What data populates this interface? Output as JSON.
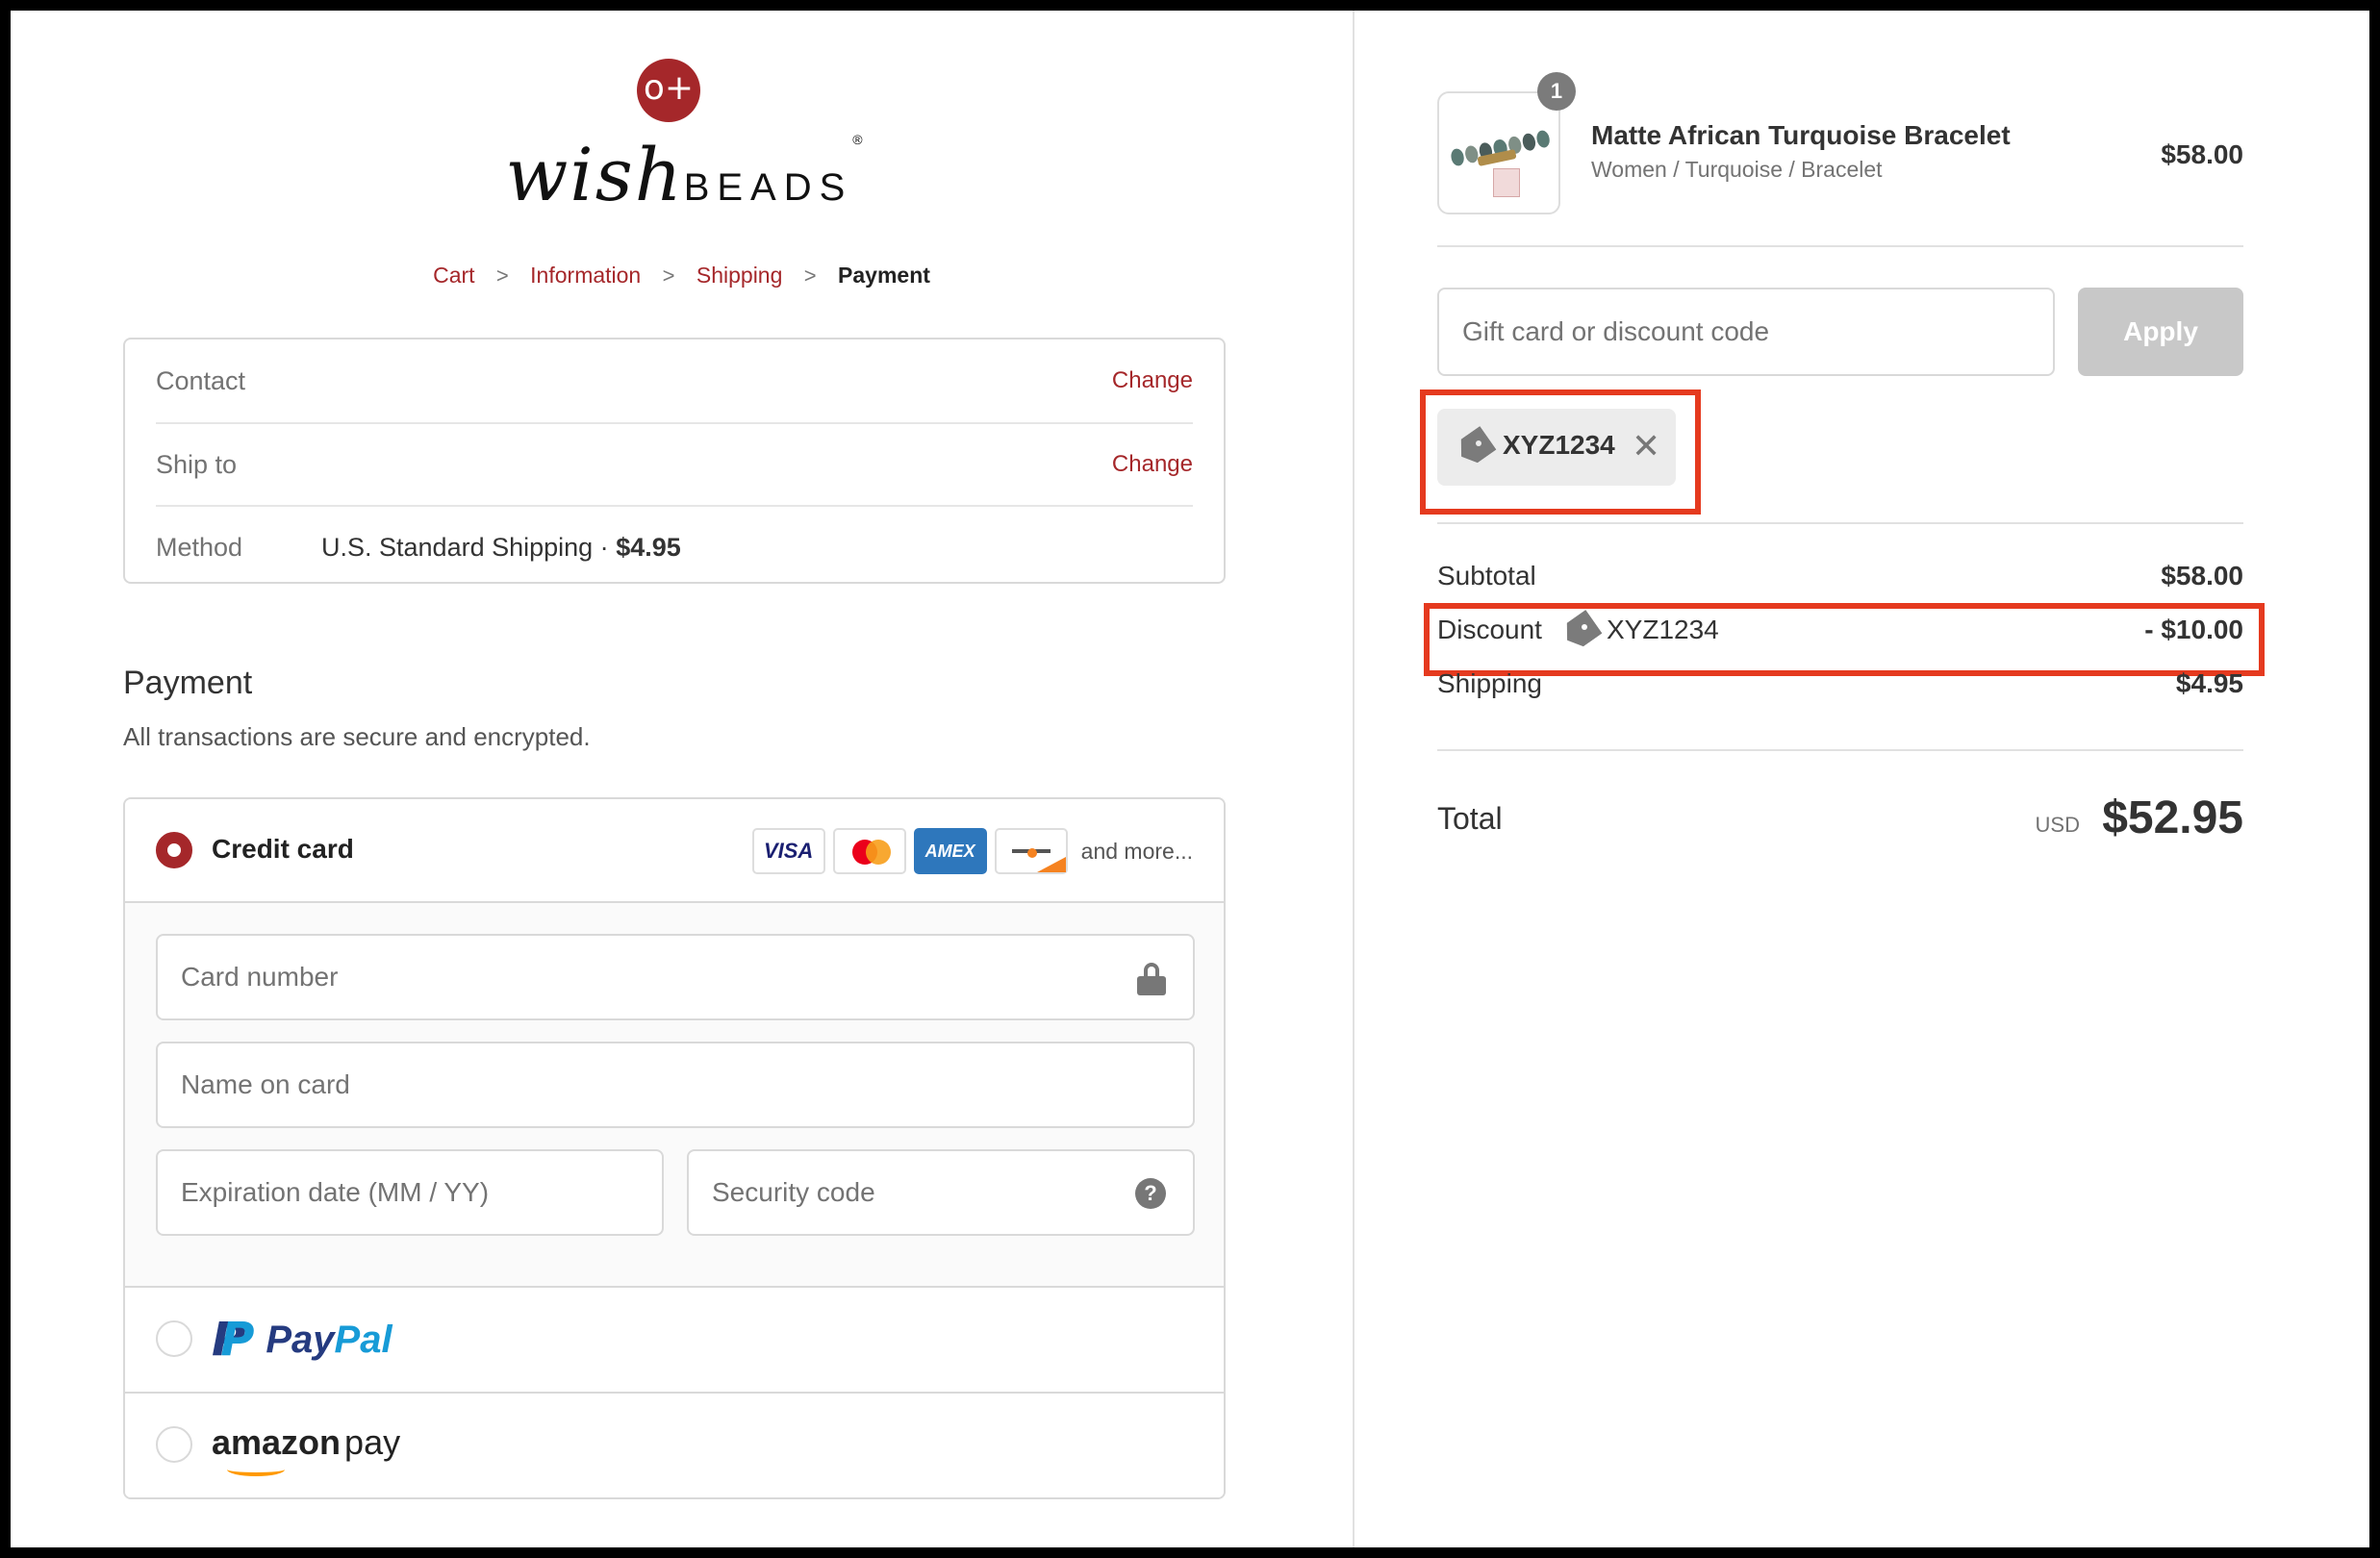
{
  "logo": {
    "mark": "o+",
    "script": "wish",
    "caps": "BEADS",
    "tm": "®"
  },
  "breadcrumb": {
    "cart": "Cart",
    "information": "Information",
    "shipping": "Shipping",
    "payment": "Payment",
    "separator": ">"
  },
  "review": {
    "contact_label": "Contact",
    "ship_to_label": "Ship to",
    "method_label": "Method",
    "method_value": "U.S. Standard Shipping · ",
    "method_price": "$4.95",
    "change_label": "Change"
  },
  "payment": {
    "title": "Payment",
    "subtitle": "All transactions are secure and encrypted.",
    "credit_card": {
      "label": "Credit card",
      "selected": true,
      "brands": {
        "visa": "VISA",
        "amex": "AMEX"
      },
      "and_more": "and more...",
      "card_number_placeholder": "Card number",
      "name_placeholder": "Name on card",
      "expiry_placeholder": "Expiration date (MM / YY)",
      "security_placeholder": "Security code",
      "help_glyph": "?"
    },
    "paypal": {
      "pay": "Pay",
      "pal": "Pal",
      "mark": "P"
    },
    "amazon": {
      "brand": "amazon",
      "pay": "pay"
    }
  },
  "order": {
    "item": {
      "quantity": "1",
      "name": "Matte African Turquoise Bracelet",
      "variant": "Women / Turquoise / Bracelet",
      "price": "$58.00"
    },
    "discount_input": {
      "placeholder": "Gift card or discount code",
      "apply_label": "Apply"
    },
    "applied_code": "XYZ1234",
    "remove_glyph": "✕",
    "subtotal_label": "Subtotal",
    "subtotal_value": "$58.00",
    "discount_label": "Discount",
    "discount_code": "XYZ1234",
    "discount_value": "- $10.00",
    "shipping_label": "Shipping",
    "shipping_value": "$4.95",
    "total_label": "Total",
    "total_currency": "USD",
    "total_value": "$52.95"
  },
  "colors": {
    "brand": "#a5272a",
    "highlight": "#e53a1f",
    "apply_disabled": "#c8c8c8"
  }
}
